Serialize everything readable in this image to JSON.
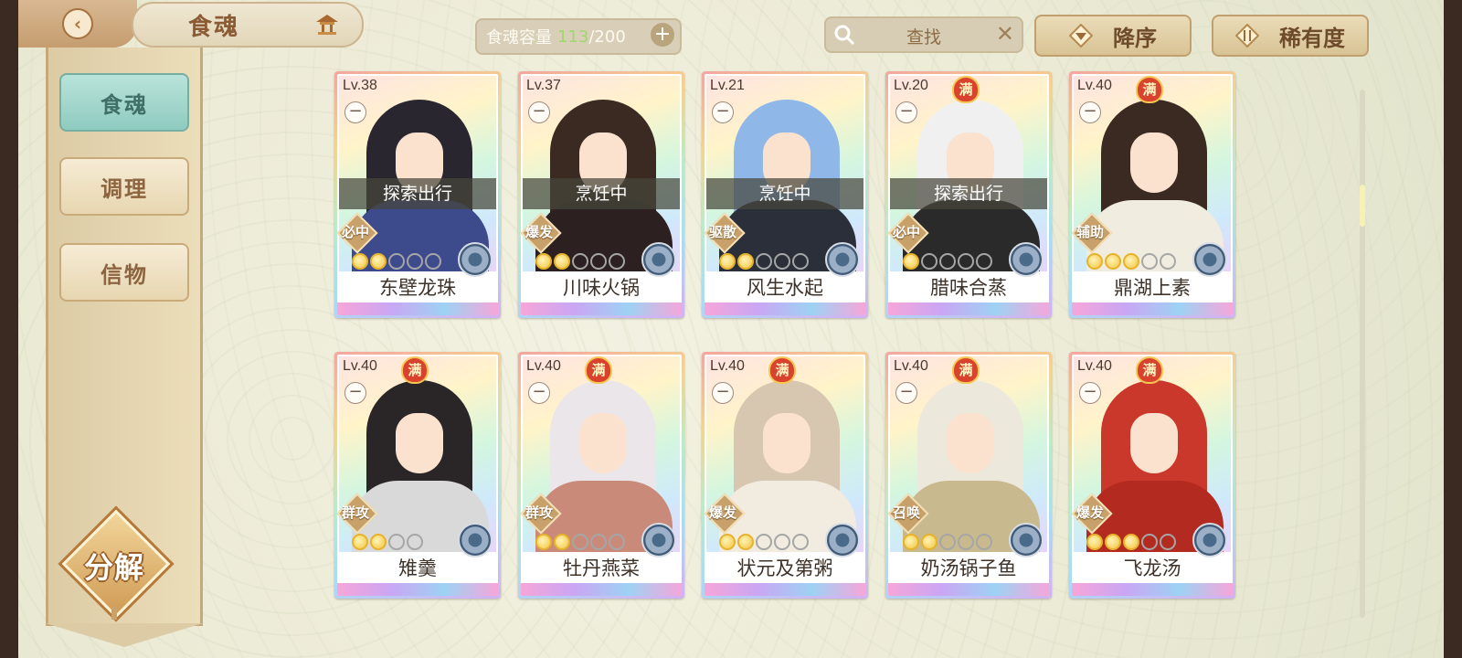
{
  "header": {
    "title": "食魂",
    "capacity_label": "食魂容量",
    "capacity_current": "113",
    "capacity_max": "/200",
    "search_label": "查找",
    "sort_label": "降序",
    "rarity_label": "稀有度"
  },
  "sidebar": {
    "items": [
      {
        "label": "食魂",
        "active": true
      },
      {
        "label": "调理",
        "active": false
      },
      {
        "label": "信物",
        "active": false
      }
    ],
    "decompose_label": "分解"
  },
  "cards": [
    {
      "level": "Lv.38",
      "full": "",
      "status": "探索出行",
      "role": "必中",
      "stars_on": 2,
      "stars": 5,
      "name": "东壁龙珠"
    },
    {
      "level": "Lv.37",
      "full": "",
      "status": "烹饪中",
      "role": "爆发",
      "stars_on": 2,
      "stars": 5,
      "name": "川味火锅"
    },
    {
      "level": "Lv.21",
      "full": "",
      "status": "烹饪中",
      "role": "驱散",
      "stars_on": 2,
      "stars": 5,
      "name": "风生水起"
    },
    {
      "level": "Lv.20",
      "full": "满",
      "status": "探索出行",
      "role": "必中",
      "stars_on": 1,
      "stars": 5,
      "name": "腊味合蒸"
    },
    {
      "level": "Lv.40",
      "full": "满",
      "status": "",
      "role": "辅助",
      "stars_on": 3,
      "stars": 5,
      "name": "鼎湖上素"
    },
    {
      "level": "Lv.40",
      "full": "满",
      "status": "",
      "role": "群攻",
      "stars_on": 2,
      "stars": 4,
      "name": "雉羹"
    },
    {
      "level": "Lv.40",
      "full": "满",
      "status": "",
      "role": "群攻",
      "stars_on": 2,
      "stars": 5,
      "name": "牡丹燕菜"
    },
    {
      "level": "Lv.40",
      "full": "满",
      "status": "",
      "role": "爆发",
      "stars_on": 2,
      "stars": 5,
      "name": "状元及第粥"
    },
    {
      "level": "Lv.40",
      "full": "满",
      "status": "",
      "role": "召唤",
      "stars_on": 2,
      "stars": 5,
      "name": "奶汤锅子鱼"
    },
    {
      "level": "Lv.40",
      "full": "满",
      "status": "",
      "role": "爆发",
      "stars_on": 3,
      "stars": 5,
      "name": "飞龙汤"
    }
  ],
  "colors": {
    "accent_teal": "#8fcbc0",
    "gold": "#c8a16a",
    "full_badge": "#d9432e",
    "capacity_green": "#9fd86e"
  }
}
